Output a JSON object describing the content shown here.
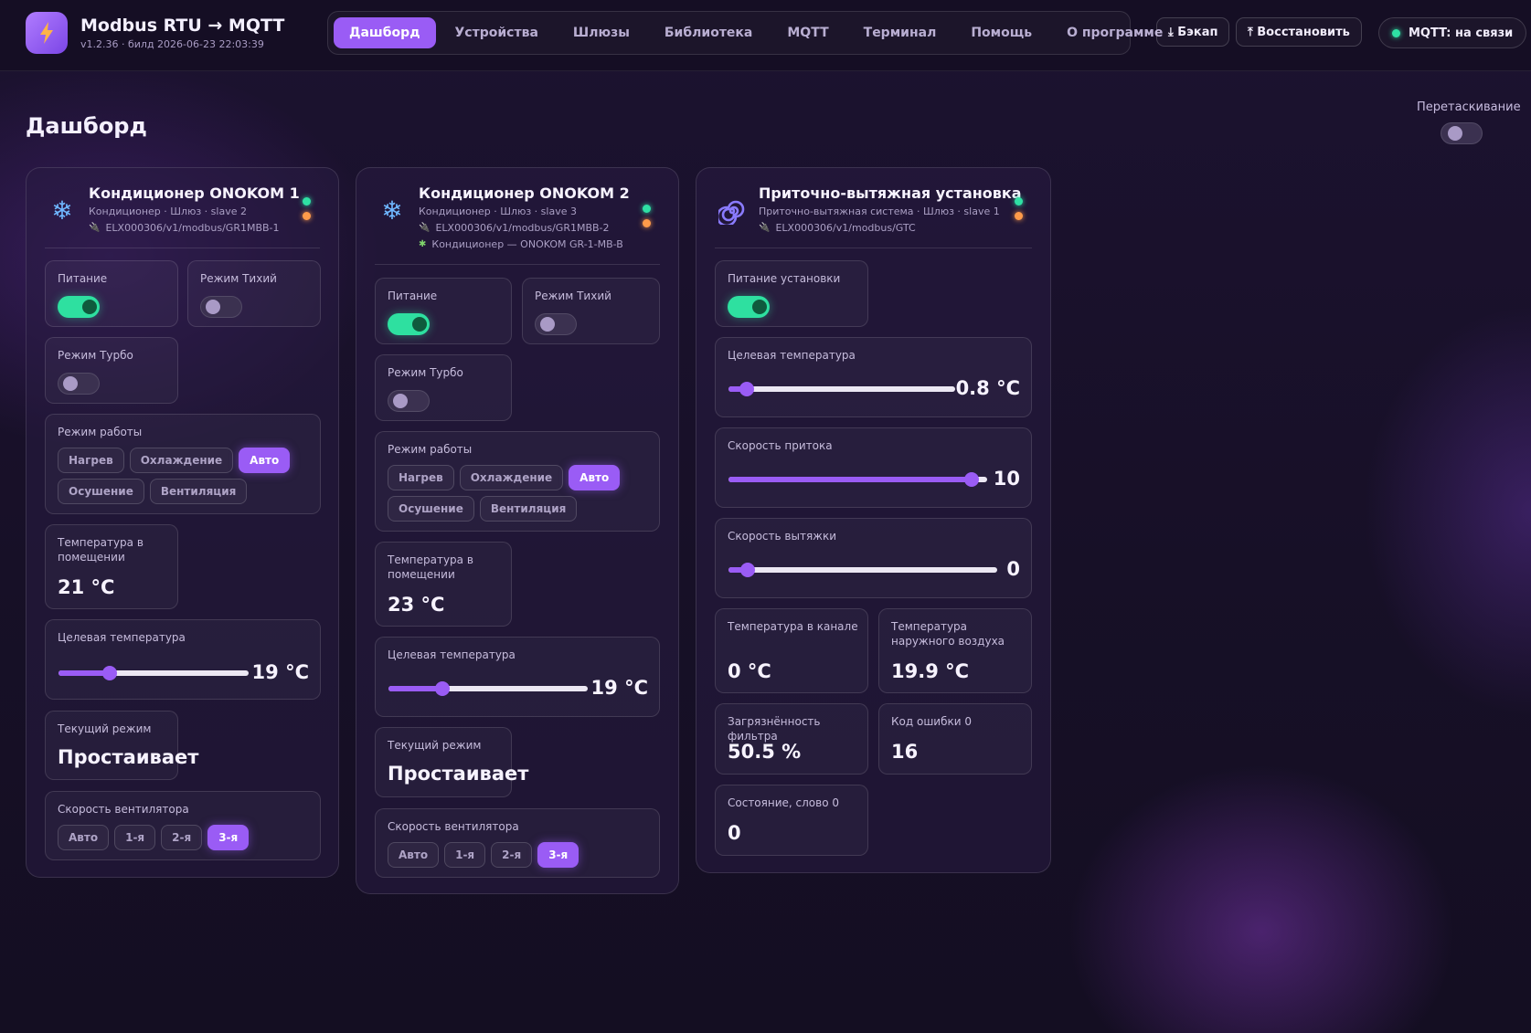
{
  "header": {
    "app_title": "Modbus RTU → MQTT",
    "app_subtitle": "v1.2.36 · билд 2026-06-23 22:03:39",
    "logo_icon": "lightning-icon",
    "nav": [
      {
        "label": "Дашборд",
        "active": true
      },
      {
        "label": "Устройства",
        "active": false
      },
      {
        "label": "Шлюзы",
        "active": false
      },
      {
        "label": "Библиотека",
        "active": false
      },
      {
        "label": "MQTT",
        "active": false
      },
      {
        "label": "Терминал",
        "active": false
      },
      {
        "label": "Помощь",
        "active": false
      },
      {
        "label": "О программе",
        "active": false
      }
    ],
    "backup_label": "⤓ Бэкап",
    "restore_label": "⤒ Восстановить",
    "mqtt_status": "MQTT: на связи"
  },
  "page": {
    "title": "Дашборд",
    "drag_label": "Перетаскивание",
    "drag_enabled": false
  },
  "colors": {
    "accent": "#9a5cf5",
    "on": "#2ee0a0",
    "status_green": "#2fe0a4",
    "status_orange": "#ff9b4a"
  },
  "cards": [
    {
      "title": "Кондиционер ONOKOM 1",
      "meta": "Кондиционер · Шлюз · slave 2",
      "topic": "ELX000306/v1/modbus/GR1MBB-1",
      "icon": "snowflake-icon",
      "power_label": "Питание",
      "power_on": true,
      "quiet_label": "Режим Тихий",
      "quiet_on": false,
      "turbo_label": "Режим Турбо",
      "turbo_on": false,
      "mode_label": "Режим работы",
      "modes": [
        "Нагрев",
        "Охлаждение",
        "Авто",
        "Осушение",
        "Вентиляция"
      ],
      "mode_active": "Авто",
      "room_temp_label": "Температура в помещении",
      "room_temp": "21 °C",
      "target_label": "Целевая температура",
      "target_value": "19 °C",
      "target_fraction": 0.27,
      "current_mode_label": "Текущий режим",
      "current_mode": "Простаивает",
      "fan_label": "Скорость вентилятора",
      "fan_speeds": [
        "Авто",
        "1-я",
        "2-я",
        "3-я"
      ],
      "fan_active": "3-я"
    },
    {
      "title": "Кондиционер ONOKOM 2",
      "meta": "Кондиционер · Шлюз · slave 3",
      "topic": "ELX000306/v1/modbus/GR1MBB-2",
      "template": "Кондиционер — ONOKOM GR-1-MB-B",
      "icon": "snowflake-icon",
      "power_label": "Питание",
      "power_on": true,
      "quiet_label": "Режим Тихий",
      "quiet_on": false,
      "turbo_label": "Режим Турбо",
      "turbo_on": false,
      "mode_label": "Режим работы",
      "modes": [
        "Нагрев",
        "Охлаждение",
        "Авто",
        "Осушение",
        "Вентиляция"
      ],
      "mode_active": "Авто",
      "room_temp_label": "Температура в помещении",
      "room_temp": "23 °C",
      "target_label": "Целевая температура",
      "target_value": "19 °C",
      "target_fraction": 0.27,
      "current_mode_label": "Текущий режим",
      "current_mode": "Простаивает",
      "fan_label": "Скорость вентилятора",
      "fan_speeds": [
        "Авто",
        "1-я",
        "2-я",
        "3-я"
      ],
      "fan_active": "3-я"
    },
    {
      "title": "Приточно-вытяжная установка",
      "meta": "Приточно-вытяжная система · Шлюз · slave 1",
      "topic": "ELX000306/v1/modbus/GTC",
      "icon": "spiral-icon",
      "power_label": "Питание установки",
      "power_on": true,
      "target_label": "Целевая температура",
      "target_value": "0.8 °C",
      "target_fraction": 0.08,
      "supply_label": "Скорость притока",
      "supply_value": "10",
      "supply_fraction": 0.94,
      "exhaust_label": "Скорость вытяжки",
      "exhaust_value": "0",
      "exhaust_fraction": 0.07,
      "duct_temp_label": "Температура в канале",
      "duct_temp": "0 °C",
      "outdoor_temp_label": "Температура наружного воздуха",
      "outdoor_temp": "19.9 °C",
      "filter_label": "Загрязнённость фильтра",
      "filter_value": "50.5 %",
      "error_label": "Код ошибки 0",
      "error_value": "16",
      "state_label": "Состояние, слово 0",
      "state_value": "0"
    }
  ]
}
